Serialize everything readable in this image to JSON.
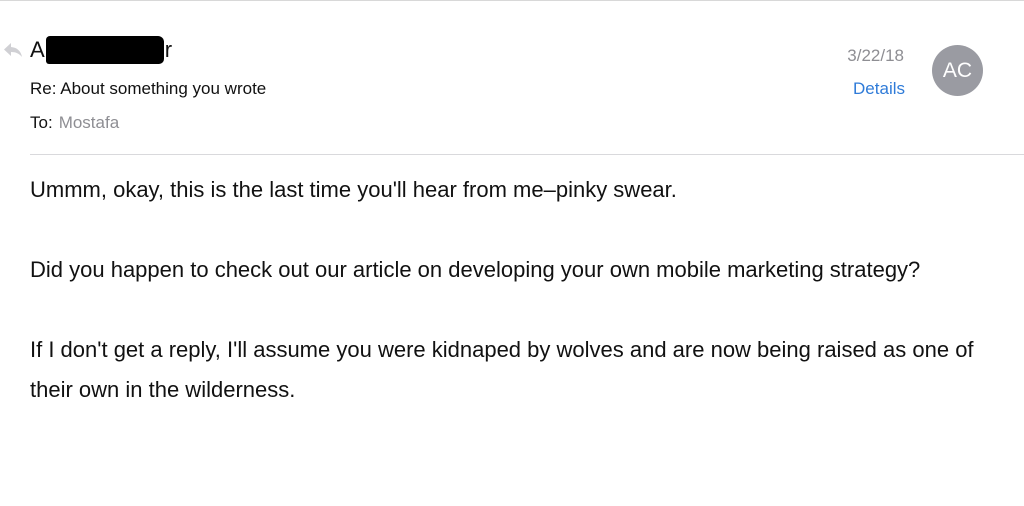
{
  "message": {
    "sender_prefix": "A",
    "sender_suffix": "r",
    "subject": "Re: About something you wrote",
    "to_label": "To:",
    "to_name": "Mostafa",
    "date": "3/22/18",
    "details_label": "Details",
    "avatar_initials": "AC",
    "body": [
      "Ummm, okay, this is the last time you'll hear from me–pinky swear.",
      "Did you happen to check out our article on developing your own mobile marketing strategy?",
      "If I don't get a reply, I'll assume you were kidnaped by wolves and are now being raised as one of their own in the wilderness."
    ]
  },
  "icons": {
    "reply": "reply-arrow-icon",
    "redaction": "redaction-mark"
  },
  "colors": {
    "link": "#2f7bd8",
    "muted": "#8e8e93",
    "avatar_bg": "#9a9ba2"
  }
}
